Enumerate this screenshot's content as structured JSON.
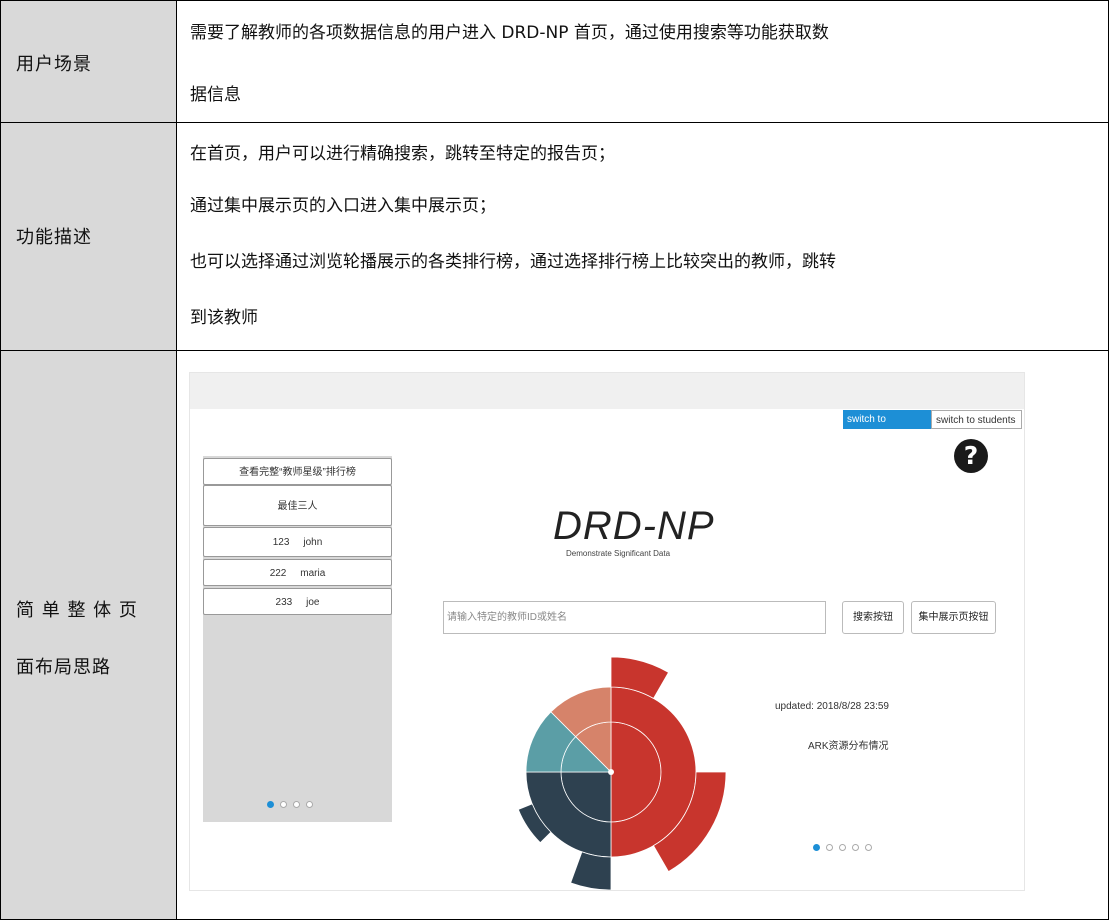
{
  "rows": [
    {
      "label": "用户场景",
      "lines": [
        "需要了解教师的各项数据信息的用户进入 DRD-NP 首页，通过使用搜索等功能获取数",
        "据信息"
      ]
    },
    {
      "label": "功能描述",
      "lines": [
        "在首页，用户可以进行精确搜索，跳转至特定的报告页；",
        "通过集中展示页的入口进入集中展示页；",
        "也可以选择通过浏览轮播展示的各类排行榜，通过选择排行榜上比较突出的教师，跳转",
        "到该教师"
      ]
    },
    {
      "label_lines": [
        "简 单 整 体 页",
        "面布局思路"
      ]
    }
  ],
  "mockup": {
    "switch_teachers": "switch to teachers",
    "switch_students": "switch to students",
    "help_icon": "question-circle-icon",
    "help_glyph": "?",
    "leaderboard": {
      "view_full": "查看完整“教师星级”排行榜",
      "header": "最佳三人",
      "entries": [
        {
          "score": "123",
          "name": "john"
        },
        {
          "score": "222",
          "name": "maria"
        },
        {
          "score": "233",
          "name": "joe"
        }
      ],
      "carousel_pages": 4,
      "carousel_active": 0
    },
    "brand_title": "DRD-NP",
    "brand_subtitle": "Demonstrate Significant Data",
    "search_placeholder": "请输入特定的教师ID或姓名",
    "search_button": "搜索按钮",
    "showcase_button": "集中展示页按钮",
    "updated": "updated: 2018/8/28 23:59",
    "chart_caption": "ARK资源分布情况",
    "chart_pages": 5,
    "chart_active": 0,
    "colors": {
      "red": "#c8352d",
      "navy": "#2e4150",
      "teal": "#5b9ea6",
      "salmon": "#d6836a",
      "blue": "#1d8fd6"
    }
  }
}
